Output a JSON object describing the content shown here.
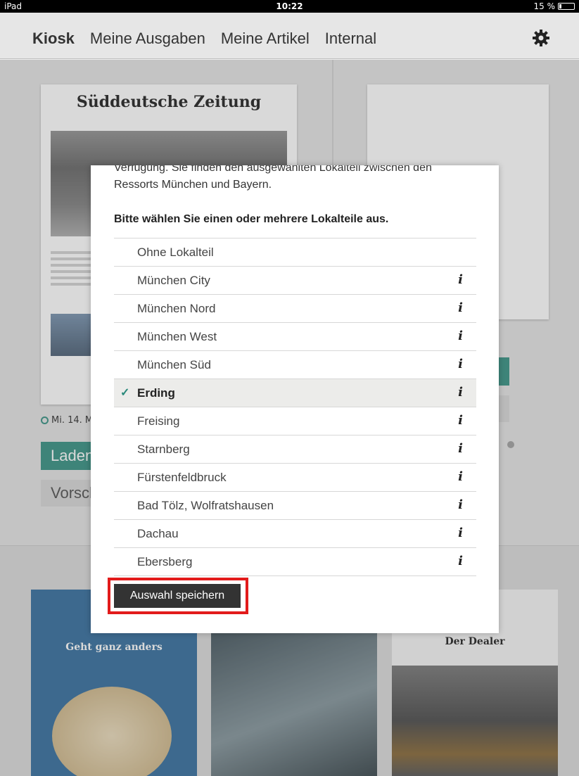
{
  "status_bar": {
    "device": "iPad",
    "time": "10:22",
    "battery": "15 %"
  },
  "nav": {
    "tabs": [
      {
        "label": "Kiosk",
        "active": true
      },
      {
        "label": "Meine Ausgaben",
        "active": false
      },
      {
        "label": "Meine Artikel",
        "active": false
      },
      {
        "label": "Internal",
        "active": false
      }
    ],
    "settings_icon": "gear-icon"
  },
  "background": {
    "masthead": "Süddeutsche Zeitung",
    "date": "Mi. 14. M",
    "load_label": "Laden",
    "preview_label": "Vorsch",
    "magazine_left_title": "Geht ganz anders",
    "magazine_right_title": "Der Dealer"
  },
  "modal": {
    "intro_line1": "Verfügung. Sie finden den ausgewählten Lokalteil zwischen den",
    "intro_line2": "Ressorts München und Bayern.",
    "prompt": "Bitte wählen Sie einen oder mehrere Lokalteile aus.",
    "options": [
      {
        "label": "Ohne Lokalteil",
        "info": ""
      },
      {
        "label": "München City",
        "info": "i"
      },
      {
        "label": "München Nord",
        "info": "i"
      },
      {
        "label": "München West",
        "info": "i"
      },
      {
        "label": "München Süd",
        "info": "i"
      },
      {
        "label": "Erding",
        "info": "i",
        "selected": true,
        "check": "✓"
      },
      {
        "label": "Freising",
        "info": "i"
      },
      {
        "label": "Starnberg",
        "info": "i"
      },
      {
        "label": "Fürstenfeldbruck",
        "info": "i"
      },
      {
        "label": "Bad Tölz, Wolfratshausen",
        "info": "i"
      },
      {
        "label": "Dachau",
        "info": "i"
      },
      {
        "label": "Ebersberg",
        "info": "i"
      }
    ],
    "save_label": "Auswahl speichern"
  },
  "colors": {
    "accent": "#29897b",
    "highlight_frame": "#e21b1b",
    "button_dark": "#333333"
  }
}
